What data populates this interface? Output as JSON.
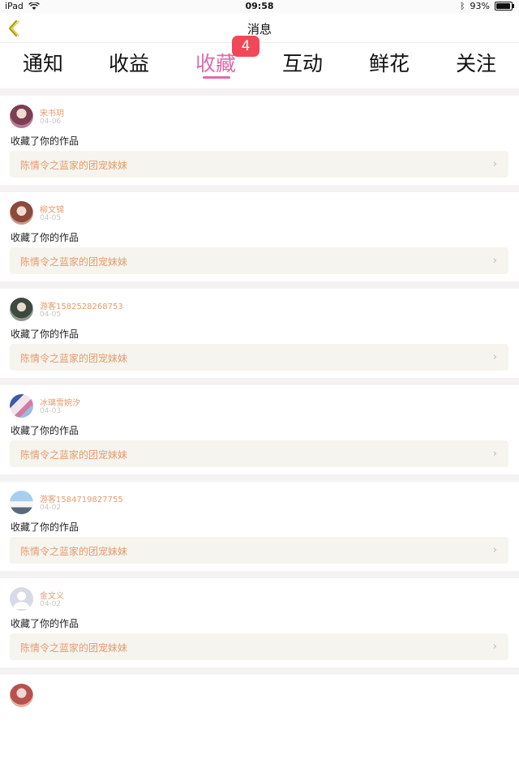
{
  "status_bar": {
    "device": "iPad",
    "time": "09:58",
    "battery": "93%",
    "battery_fraction": 0.93
  },
  "header": {
    "title": "消息"
  },
  "tabs": [
    {
      "label": "通知"
    },
    {
      "label": "收益"
    },
    {
      "label": "收藏",
      "active": true,
      "badge": "4"
    },
    {
      "label": "互动"
    },
    {
      "label": "鲜花"
    },
    {
      "label": "关注"
    }
  ],
  "colors": {
    "accent": "#e06aa9",
    "badge": "#f04859",
    "username": "#e69a6e",
    "card_bg": "#f5f4ee"
  },
  "notifications": [
    {
      "username": "宋书玥",
      "date": "04-06",
      "action": "收藏了你的作品",
      "work_title": "陈情令之蓝家的团宠妹妹"
    },
    {
      "username": "柳文锦",
      "date": "04-05",
      "action": "收藏了你的作品",
      "work_title": "陈情令之蓝家的团宠妹妹"
    },
    {
      "username": "游客1582528268753",
      "date": "04-05",
      "action": "收藏了你的作品",
      "work_title": "陈情令之蓝家的团宠妹妹"
    },
    {
      "username": "冰璃雪婉汐",
      "date": "04-03",
      "action": "收藏了你的作品",
      "work_title": "陈情令之蓝家的团宠妹妹"
    },
    {
      "username": "游客1584719827755",
      "date": "04-02",
      "action": "收藏了你的作品",
      "work_title": "陈情令之蓝家的团宠妹妹"
    },
    {
      "username": "金文义",
      "date": "04-02",
      "action": "收藏了你的作品",
      "work_title": "陈情令之蓝家的团宠妹妹"
    }
  ]
}
